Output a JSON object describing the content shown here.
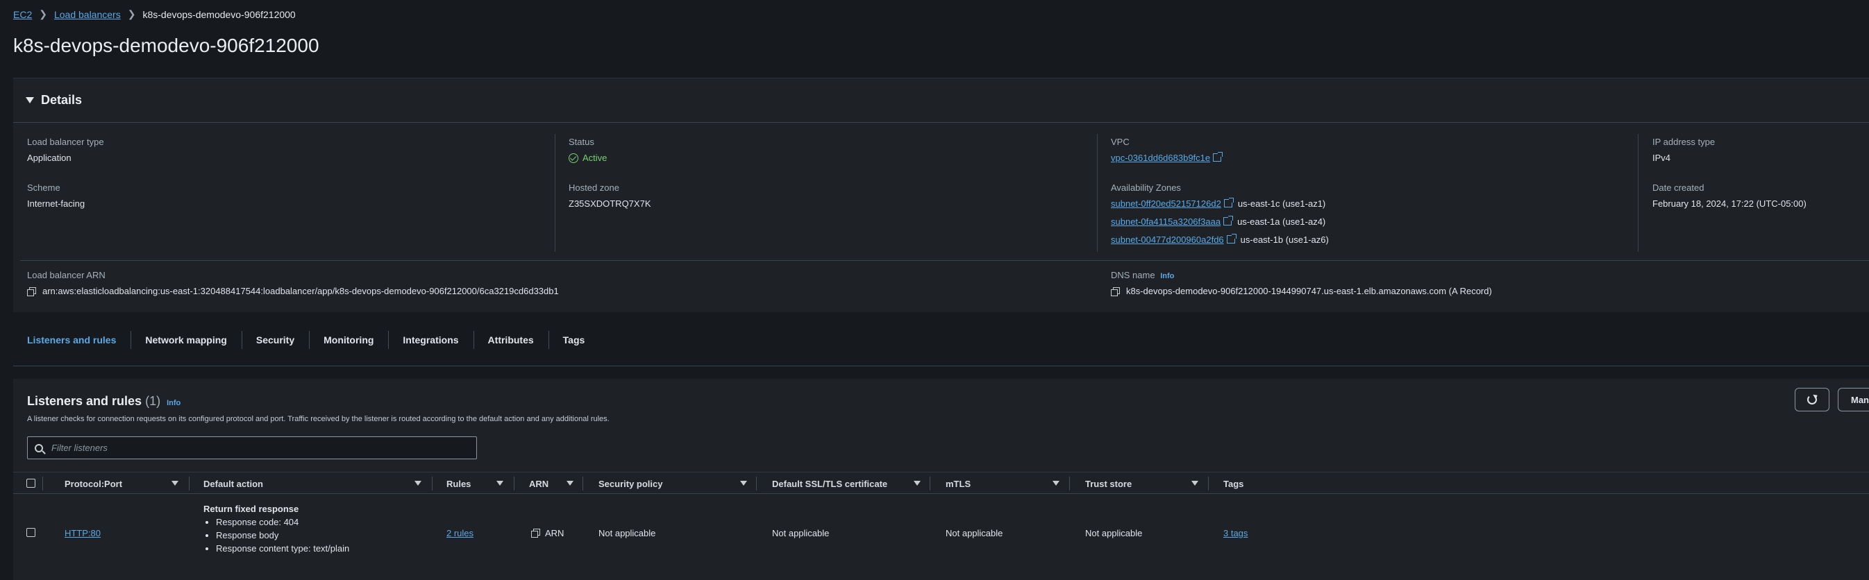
{
  "breadcrumb": {
    "items": [
      "EC2",
      "Load balancers"
    ],
    "current": "k8s-devops-demodevo-906f212000"
  },
  "page_title": "k8s-devops-demodevo-906f212000",
  "details": {
    "title": "Details",
    "lb_type_label": "Load balancer type",
    "lb_type_value": "Application",
    "scheme_label": "Scheme",
    "scheme_value": "Internet-facing",
    "status_label": "Status",
    "status_value": "Active",
    "hosted_zone_label": "Hosted zone",
    "hosted_zone_value": "Z35SXDOTRQ7X7K",
    "vpc_label": "VPC",
    "vpc_value": "vpc-0361dd6d683b9fc1e",
    "az_label": "Availability Zones",
    "subnets": [
      {
        "id": "subnet-0ff20ed52157126d2",
        "zone": "us-east-1c (use1-az1)"
      },
      {
        "id": "subnet-0fa4115a3206f3aaa",
        "zone": "us-east-1a (use1-az4)"
      },
      {
        "id": "subnet-00477d200960a2fd6",
        "zone": "us-east-1b (use1-az6)"
      }
    ],
    "ip_type_label": "IP address type",
    "ip_type_value": "IPv4",
    "date_label": "Date created",
    "date_value": "February 18, 2024, 17:22 (UTC-05:00)",
    "arn_label": "Load balancer ARN",
    "arn_value": "arn:aws:elasticloadbalancing:us-east-1:320488417544:loadbalancer/app/k8s-devops-demodevo-906f212000/6ca3219cd6d33db1",
    "dns_label": "DNS name",
    "dns_info": "Info",
    "dns_value": "k8s-devops-demodevo-906f212000-1944990747.us-east-1.elb.amazonaws.com (A Record)"
  },
  "tabs": [
    "Listeners and rules",
    "Network mapping",
    "Security",
    "Monitoring",
    "Integrations",
    "Attributes",
    "Tags"
  ],
  "listeners": {
    "title": "Listeners and rules",
    "count": "(1)",
    "info": "Info",
    "description": "A listener checks for connection requests on its configured protocol and port. Traffic received by the listener is routed according to the default action and any additional rules.",
    "filter_placeholder": "Filter listeners",
    "manage_label": "Manage",
    "columns": [
      "Protocol:Port",
      "Default action",
      "Rules",
      "ARN",
      "Security policy",
      "Default SSL/TLS certificate",
      "mTLS",
      "Trust store",
      "Tags"
    ],
    "row": {
      "protocol_port": "HTTP:80",
      "action_title": "Return fixed response",
      "action_items": [
        "Response code: 404",
        "Response body",
        "Response content type: text/plain"
      ],
      "rules": "2 rules",
      "arn": "ARN",
      "security_policy": "Not applicable",
      "certificate": "Not applicable",
      "mtls": "Not applicable",
      "trust_store": "Not applicable",
      "tags": "3 tags"
    }
  }
}
